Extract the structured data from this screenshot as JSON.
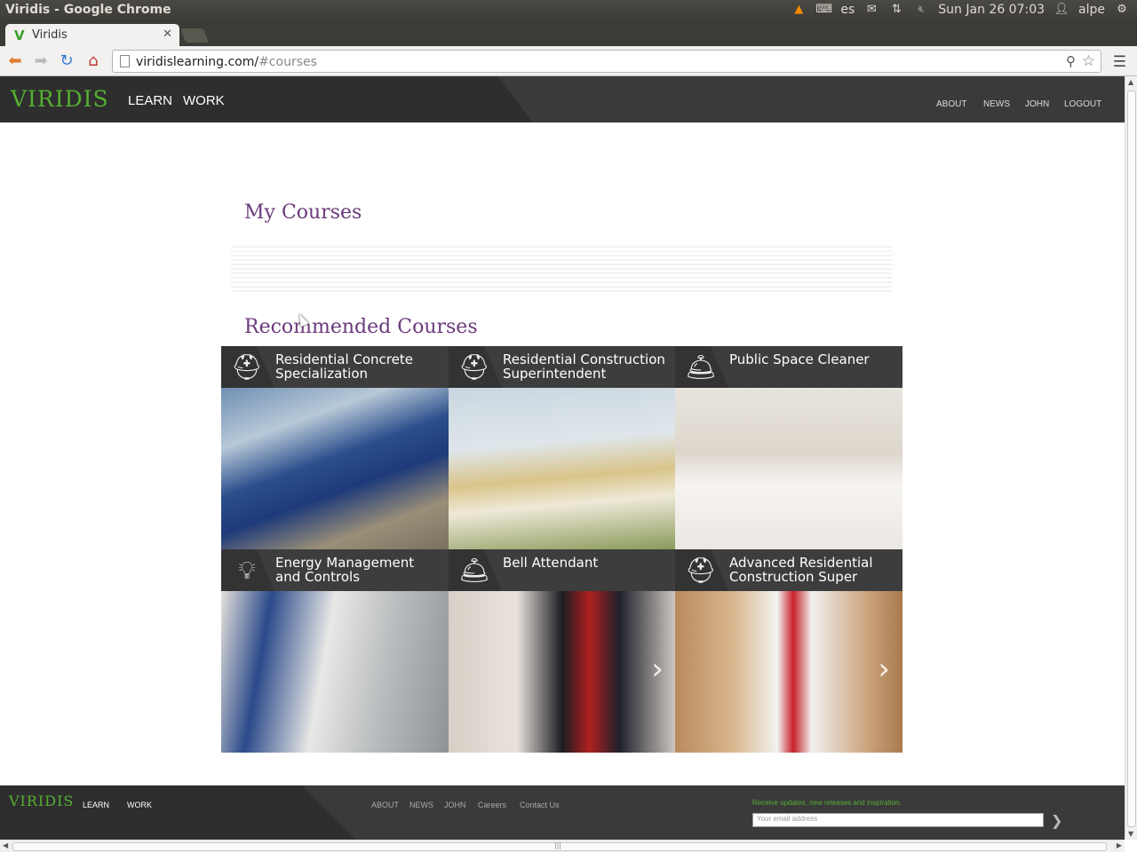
{
  "os": {
    "window_title": "Viridis - Google Chrome",
    "keyboard_layout": "es",
    "clock": "Sun Jan 26 07:03",
    "user": "alpe",
    "tray_icons": [
      "vlc-icon",
      "keyboard-icon",
      "mail-icon",
      "network-icon",
      "volume-muted-icon",
      "user-icon",
      "power-gear-icon"
    ]
  },
  "browser": {
    "tab_title": "Viridis",
    "url_host": "viridislearning.com/",
    "url_path": "#courses",
    "icons": [
      "back-icon",
      "forward-icon",
      "reload-icon",
      "home-icon",
      "zoom-icon",
      "star-icon",
      "menu-icon"
    ]
  },
  "site": {
    "logo": "VIRIDIS",
    "nav": {
      "learn": "LEARN",
      "work": "WORK"
    },
    "right_nav": {
      "about": "ABOUT",
      "news": "NEWS",
      "john": "JOHN",
      "logout": "LOGOUT"
    },
    "accent_color": "#55b032",
    "heading_color": "#6a3a7c"
  },
  "main": {
    "my_courses_title": "My Courses",
    "recommended_title": "Recommended Courses",
    "courses": [
      {
        "title": "Residential Concrete Specialization",
        "icon": "hardhat-icon"
      },
      {
        "title": "Residential Construction Superintendent",
        "icon": "hardhat-icon"
      },
      {
        "title": "Public Space Cleaner",
        "icon": "service-bell-icon"
      },
      {
        "title": "Energy Management and Controls",
        "icon": "lightbulb-icon"
      },
      {
        "title": "Bell Attendant",
        "icon": "service-bell-icon"
      },
      {
        "title": "Advanced Residential Construction Super",
        "icon": "hardhat-icon"
      }
    ]
  },
  "footer": {
    "logo": "VIRIDIS",
    "learn": "LEARN",
    "work": "WORK",
    "links": {
      "about": "ABOUT",
      "news": "NEWS",
      "john": "JOHN",
      "careers": "Careers",
      "contact": "Contact Us"
    },
    "newsletter_label": "Receive updates, new releases and inspiration.",
    "email_placeholder": "Your email address"
  }
}
